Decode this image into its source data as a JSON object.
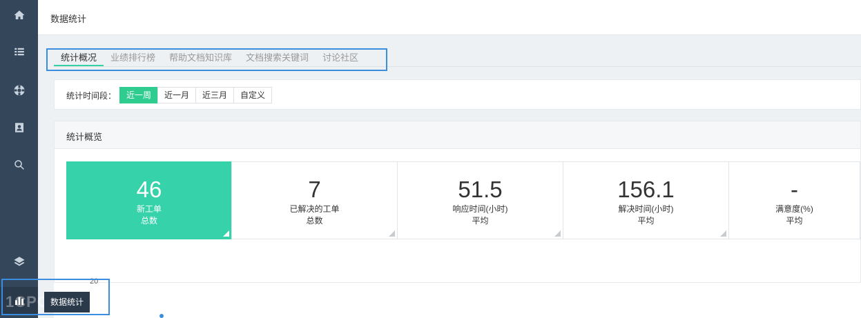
{
  "header": {
    "title": "数据统计"
  },
  "sidebar": {
    "items": [
      {
        "icon": "home-icon"
      },
      {
        "icon": "list-icon"
      },
      {
        "icon": "lifebuoy-icon"
      },
      {
        "icon": "contact-card-icon"
      },
      {
        "icon": "search-icon"
      },
      {
        "icon": "layers-icon"
      },
      {
        "icon": "bar-chart-icon",
        "active": true
      }
    ],
    "tooltip": "数据统计"
  },
  "tabs": [
    {
      "label": "统计概况",
      "active": true
    },
    {
      "label": "业绩排行榜"
    },
    {
      "label": "帮助文档知识库"
    },
    {
      "label": "文档搜索关键词"
    },
    {
      "label": "讨论社区"
    }
  ],
  "filter": {
    "label": "统计时间段：",
    "options": [
      {
        "label": "近一周",
        "active": true
      },
      {
        "label": "近一月"
      },
      {
        "label": "近三月"
      },
      {
        "label": "自定义"
      }
    ]
  },
  "overview": {
    "title": "统计概览",
    "stats": [
      {
        "value": "46",
        "line1": "新工单",
        "line2": "总数",
        "active": true
      },
      {
        "value": "7",
        "line1": "已解决的工单",
        "line2": "总数"
      },
      {
        "value": "51.5",
        "line1": "响应时间(小时)",
        "line2": "平均"
      },
      {
        "value": "156.1",
        "line1": "解决时间(小时)",
        "line2": "平均"
      },
      {
        "value": "-",
        "line1": "满意度(%)",
        "line2": "平均"
      }
    ]
  },
  "chart": {
    "y_tick": "20"
  },
  "watermark": "1CPO 大数跨境",
  "colors": {
    "sidebar": "#34465a",
    "accent": "#36d3aa",
    "active_button": "#2ecc8f",
    "highlight": "#3b8de0"
  }
}
